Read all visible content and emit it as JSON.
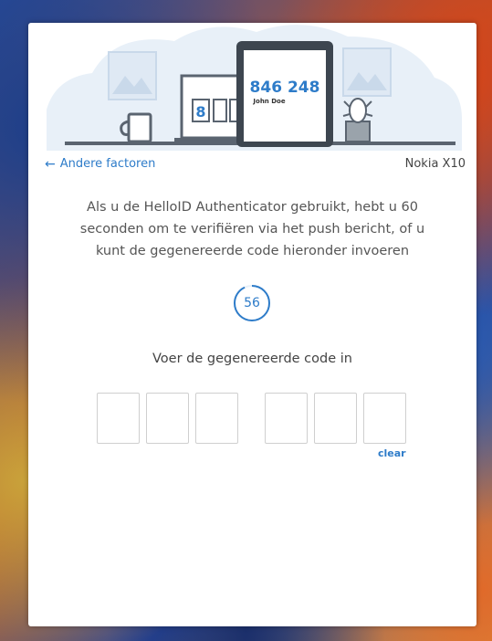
{
  "illustration": {
    "phone_code": "846 248",
    "phone_user": "John Doe",
    "laptop_digit": "8"
  },
  "nav": {
    "back_label": "Andere factoren",
    "device_name": "Nokia X10"
  },
  "instructions": "Als u de HelloID Authenticator gebruikt, hebt u 60 seconden om te verifiëren via het push bericht, of u kunt de gegenereerde code hieronder invoeren",
  "timer": {
    "seconds_remaining": "56",
    "remaining_fraction": 0.93
  },
  "code_entry": {
    "label": "Voer de gegenereerde code in",
    "digits": [
      "",
      "",
      "",
      "",
      "",
      ""
    ],
    "clear_label": "clear"
  },
  "colors": {
    "accent": "#2e7cc9",
    "illustration_bg": "#e8f0f8"
  }
}
